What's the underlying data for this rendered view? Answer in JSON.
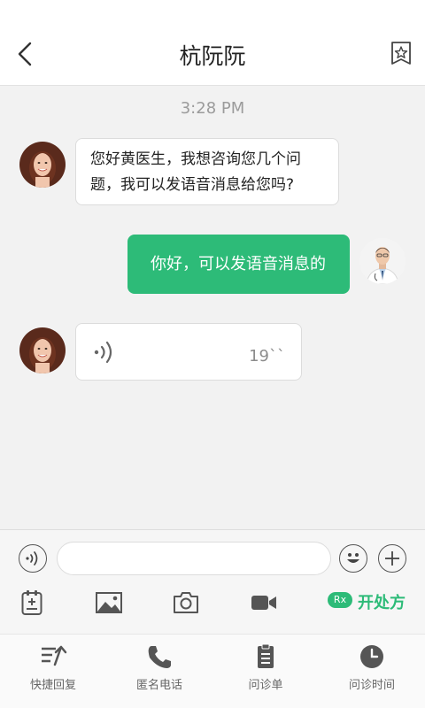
{
  "header": {
    "title": "杭阮阮",
    "back_icon": "chevron-left-icon",
    "favorite_icon": "star-bookmark-icon"
  },
  "chat": {
    "timestamp": "3:28 PM",
    "messages": [
      {
        "side": "incoming",
        "type": "text",
        "lines": [
          "您好黄医生，我想咨询您几个问",
          "题，我可以发语音消息给您吗?"
        ]
      },
      {
        "side": "outgoing",
        "type": "text",
        "text": "你好，可以发语音消息的"
      },
      {
        "side": "incoming",
        "type": "voice",
        "duration": "19``",
        "icon": "voice-wave-icon"
      }
    ]
  },
  "input_bar": {
    "value": "",
    "placeholder": "",
    "voice_icon": "voice-toggle-icon",
    "emoji_icon": "emoji-icon",
    "plus_icon": "plus-icon"
  },
  "tools": {
    "items": [
      "clipboard-add-icon",
      "image-icon",
      "camera-icon",
      "video-icon"
    ],
    "prescribe": {
      "badge": "Rx",
      "label": "开处方"
    }
  },
  "bottom_tabs": [
    {
      "label": "快捷回复",
      "icon": "quick-reply-icon"
    },
    {
      "label": "匿名电话",
      "icon": "phone-icon"
    },
    {
      "label": "问诊单",
      "icon": "clipboard-icon"
    },
    {
      "label": "问诊时间",
      "icon": "clock-icon"
    }
  ],
  "colors": {
    "accent": "#2dbb78",
    "background": "#f2f2f2",
    "timestamp": "#9b9b9b"
  }
}
